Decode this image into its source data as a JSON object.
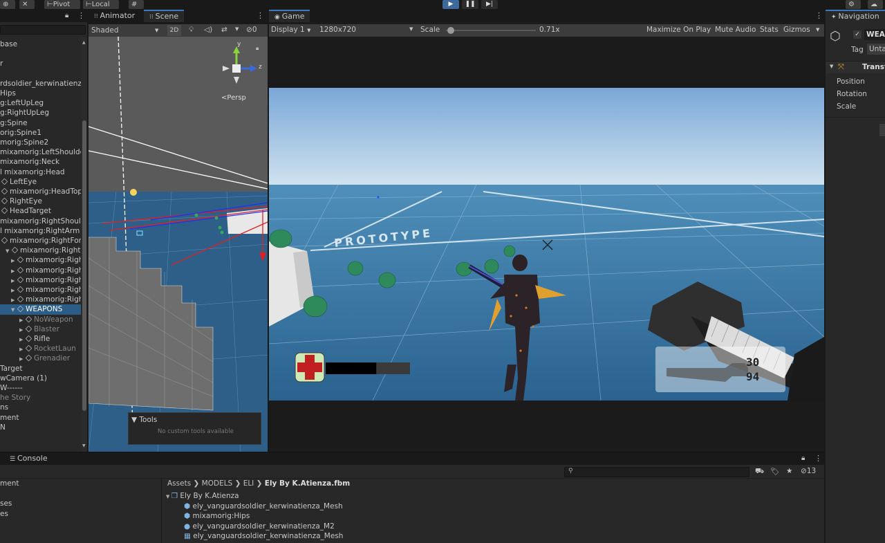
{
  "toolbar": {
    "pivot": "Pivot",
    "local": "Local"
  },
  "hierarchy": {
    "rows": [
      {
        "label": "base",
        "indent": 0
      },
      {
        "label": "",
        "indent": 0
      },
      {
        "label": "r",
        "indent": 0
      },
      {
        "label": "",
        "indent": 0
      },
      {
        "label": "rdsoldier_kerwinatienza",
        "indent": 0
      },
      {
        "label": "Hips",
        "indent": 0
      },
      {
        "label": "g:LeftUpLeg",
        "indent": 0
      },
      {
        "label": "g:RightUpLeg",
        "indent": 0
      },
      {
        "label": "g:Spine",
        "indent": 0
      },
      {
        "label": "orig:Spine1",
        "indent": 0
      },
      {
        "label": "morig:Spine2",
        "indent": 0
      },
      {
        "label": "mixamorig:LeftShoulder",
        "indent": 0
      },
      {
        "label": "mixamorig:Neck",
        "indent": 0
      },
      {
        "label": "l mixamorig:Head",
        "indent": 0
      },
      {
        "label": "LeftEye",
        "indent": 1
      },
      {
        "label": "mixamorig:HeadTop",
        "indent": 1
      },
      {
        "label": "RightEye",
        "indent": 1
      },
      {
        "label": "HeadTarget",
        "indent": 1
      },
      {
        "label": "mixamorig:RightShoulder",
        "indent": 0
      },
      {
        "label": "l mixamorig:RightArm",
        "indent": 0
      },
      {
        "label": "mixamorig:RightFore",
        "indent": 1
      },
      {
        "label": "mixamorig:RightH",
        "indent": 2
      },
      {
        "label": "mixamorig:Righ",
        "indent": 3
      },
      {
        "label": "mixamorig:Righ",
        "indent": 3
      },
      {
        "label": "mixamorig:Righ",
        "indent": 3
      },
      {
        "label": "mixamorig:Righ",
        "indent": 3
      },
      {
        "label": "mixamorig:Righ",
        "indent": 3
      },
      {
        "label": "WEAPONS",
        "indent": 3
      },
      {
        "label": "NoWeapon",
        "indent": 4
      },
      {
        "label": "Blaster",
        "indent": 4
      },
      {
        "label": "Rifle",
        "indent": 4
      },
      {
        "label": "RocketLaun",
        "indent": 4
      },
      {
        "label": "Grenadier",
        "indent": 4
      },
      {
        "label": "Target",
        "indent": 0
      },
      {
        "label": "wCamera (1)",
        "indent": 0
      },
      {
        "label": "W------",
        "indent": 0
      },
      {
        "label": "he Story",
        "indent": 0
      },
      {
        "label": "ns",
        "indent": 0
      },
      {
        "label": "ment",
        "indent": 0
      },
      {
        "label": "N",
        "indent": 0
      }
    ]
  },
  "scene": {
    "tabs": [
      "Animator",
      "Scene"
    ],
    "shading": "Shaded",
    "mode_2d": "2D",
    "hidden_count": "0",
    "gizmo_y": "y",
    "gizmo_z": "z",
    "persp": "Persp",
    "tools_title": "Tools",
    "tools_empty": "No custom tools available"
  },
  "game": {
    "tab": "Game",
    "display": "Display 1",
    "resolution": "1280x720",
    "scale_label": "Scale",
    "scale_value": "0.71x",
    "scale_level": 0.05,
    "buttons": [
      "Maximize On Play",
      "Mute Audio",
      "Stats",
      "Gizmos"
    ],
    "floor_text": "PROTOTYPE",
    "ammo_clip": "30",
    "ammo_total": "94",
    "health_level": 0.6
  },
  "inspector": {
    "tab": "Navigation",
    "object_name": "WEA",
    "tag_label": "Tag",
    "tag_value": "Unta",
    "component": "Transf",
    "fields": [
      "Position",
      "Rotation",
      "Scale"
    ]
  },
  "console": {
    "tab": "Console",
    "left_rows": [
      "ment",
      "",
      "ses",
      "es"
    ],
    "breadcrumb": [
      "Assets",
      "MODELS",
      "ELI",
      "Ely By K.Atienza.fbm"
    ],
    "root": "Ely By K.Atienza",
    "items": [
      "ely_vanguardsoldier_kerwinatienza_Mesh",
      "mixamorig:Hips",
      "ely_vanguardsoldier_kerwinatienza_M2",
      "ely_vanguardsoldier_kerwinatienza_Mesh"
    ],
    "hidden_count": "13"
  },
  "colors": {
    "accent": "#3a79bb",
    "selection": "#2c5d87",
    "play": "#3d6a9a"
  }
}
